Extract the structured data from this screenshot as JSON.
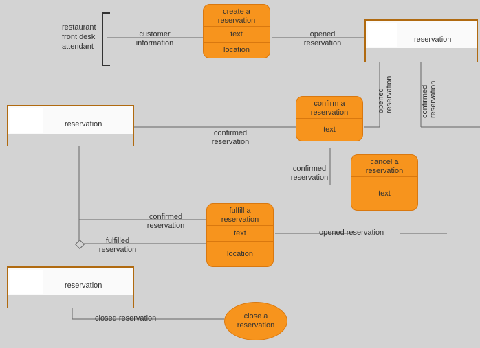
{
  "actor": {
    "label": "restaurant\nfront desk\nattendant"
  },
  "nodes": {
    "create": {
      "title": "create a\nreservation",
      "sec1": "text",
      "sec2": "location"
    },
    "confirm": {
      "title": "confirm a\nreservation",
      "sec1": "text"
    },
    "cancel": {
      "title": "cancel a\nreservation",
      "sec1": "text"
    },
    "fulfill": {
      "title": "fulfill a\nreservation",
      "sec1": "text",
      "sec2": "location"
    },
    "close": {
      "title": "close a\nreservation"
    }
  },
  "res_cards": {
    "top": "reservation",
    "left": "reservation",
    "bottom": "reservation"
  },
  "edge_labels": {
    "customer_info": "customer\ninformation",
    "opened_reservation": "opened\nreservation",
    "confirmed1": "confirmed\nreservation",
    "confirmed2": "confirmed\nreservation",
    "confirmed3": "confirmed\nreservation",
    "opened_v": "opened\nreservation",
    "confirmed_v": "confirmed\nreservation",
    "opened_h": "opened reservation",
    "fulfilled": "fulfilled\nreservation",
    "closed": "closed reservation"
  }
}
